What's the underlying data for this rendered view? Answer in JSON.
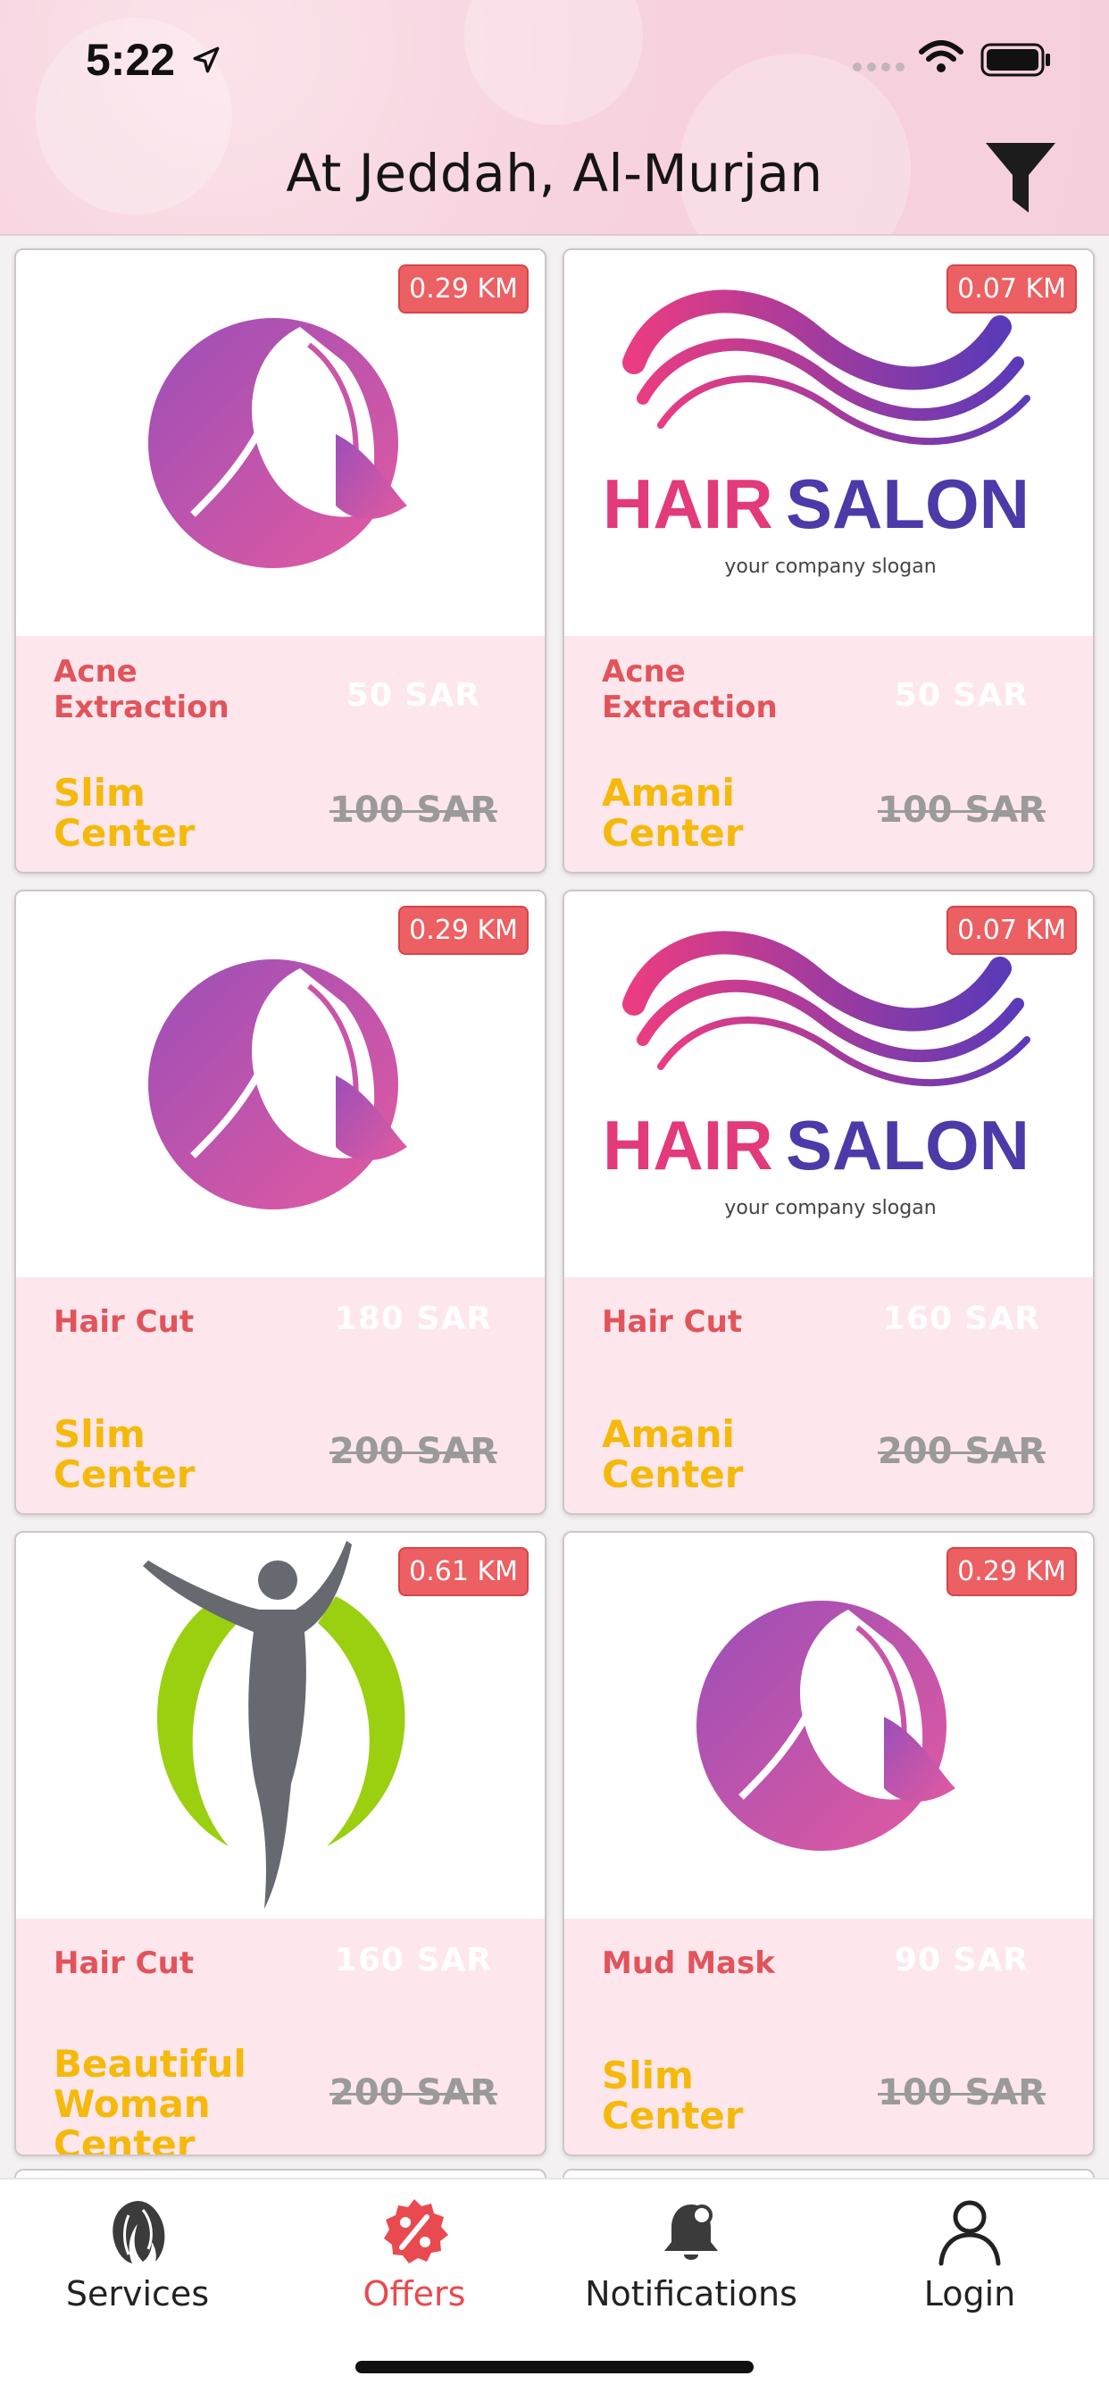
{
  "status_bar": {
    "time": "5:22"
  },
  "header": {
    "title": "At Jeddah, Al-Murjan"
  },
  "offers": [
    {
      "distance": "0.29 KM",
      "logo": "woman-profile-logo",
      "service": "Acne Extraction",
      "price_new": "50 SAR",
      "center": "Slim Center",
      "price_old": "100 SAR"
    },
    {
      "distance": "0.07 KM",
      "logo": "hair-salon-logo",
      "service": "Acne Extraction",
      "price_new": "50 SAR",
      "center": "Amani Center",
      "price_old": "100 SAR"
    },
    {
      "distance": "0.29 KM",
      "logo": "woman-profile-logo",
      "service": "Hair Cut",
      "price_new": "180 SAR",
      "center": "Slim Center",
      "price_old": "200 SAR"
    },
    {
      "distance": "0.07 KM",
      "logo": "hair-salon-logo",
      "service": "Hair Cut",
      "price_new": "160 SAR",
      "center": "Amani Center",
      "price_old": "200 SAR"
    },
    {
      "distance": "0.61 KM",
      "logo": "woman-figure-logo",
      "service": "Hair Cut",
      "price_new": "160 SAR",
      "center": "Beautiful Woman Center",
      "price_old": "200 SAR"
    },
    {
      "distance": "0.29 KM",
      "logo": "woman-profile-logo",
      "service": "Mud Mask",
      "price_new": "90 SAR",
      "center": "Slim Center",
      "price_old": "100 SAR"
    }
  ],
  "logos": {
    "hairsalon_pink": "HAIR",
    "hairsalon_purple": "SALON",
    "hairsalon_slogan": "your company slogan"
  },
  "tabbar": {
    "services": "Services",
    "offers": "Offers",
    "notifications": "Notifications",
    "login": "Login"
  },
  "colors": {
    "accent": "#e84a4f",
    "center_name": "#f5b90c",
    "service_name": "#e1545c",
    "card_bg": "#fde7ec"
  }
}
